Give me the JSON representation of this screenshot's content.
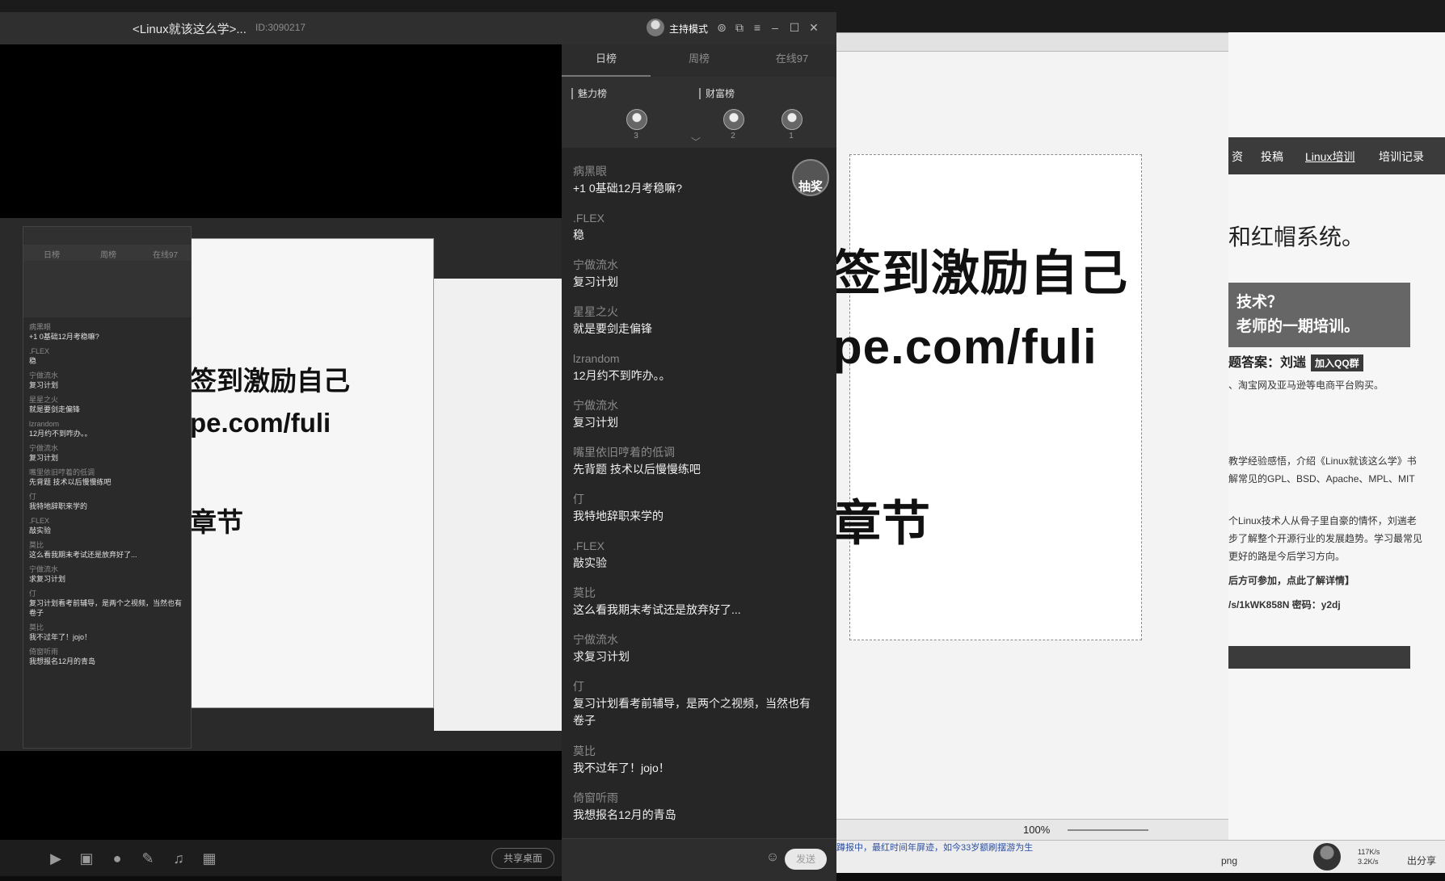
{
  "window": {
    "room_title": "<Linux就该这么学>...",
    "room_id": "ID:3090217",
    "host_mode_label": "主持模式"
  },
  "panel": {
    "tabs": [
      "日榜",
      "周榜",
      "在线97"
    ],
    "active_tab": "日榜",
    "rank_charm_label": "魅力榜",
    "rank_wealth_label": "财富榜",
    "rank_charm": [
      {
        "rank": "3"
      }
    ],
    "rank_wealth": [
      {
        "rank": "2"
      },
      {
        "rank": "1"
      }
    ],
    "lottery_label": "抽奖"
  },
  "chat": [
    {
      "name": "病黑眼",
      "text": "+1 0基础12月考稳嘛?"
    },
    {
      "name": ".FLEX",
      "text": "稳"
    },
    {
      "name": "宁做流水",
      "text": "复习计划"
    },
    {
      "name": "星星之火",
      "text": "就是要剑走偏锋"
    },
    {
      "name": "lzrandom",
      "text": "12月约不到咋办。。"
    },
    {
      "name": "宁做流水",
      "text": "复习计划"
    },
    {
      "name": "嘴里依旧哼着的低调",
      "text": "先背题 技术以后慢慢练吧"
    },
    {
      "name": "仃",
      "text": "我特地辞职来学的"
    },
    {
      "name": ".FLEX",
      "text": "敲实验"
    },
    {
      "name": "莫比",
      "text": "这么看我期末考试还是放弃好了..."
    },
    {
      "name": "宁做流水",
      "text": "求复习计划"
    },
    {
      "name": "仃",
      "text": "复习计划看考前辅导，是两个之视频，当然也有卷子"
    },
    {
      "name": "莫比",
      "text": "我不过年了！jojo！"
    },
    {
      "name": "倚窗听雨",
      "text": "我想报名12月的青岛"
    }
  ],
  "input": {
    "placeholder": "",
    "send_label": "发送"
  },
  "toolbar": {
    "share_label": "共享桌面"
  },
  "shared_screen": {
    "big_line_1": "签到激励自己",
    "big_line_2": "pe.com/fuli",
    "big_line_3": "章节",
    "zoom": "100%",
    "web_nav": [
      "资",
      "投稿",
      "Linux培训",
      "培训记录"
    ],
    "web_heading": "和红帽系统。",
    "web_banner_1": "技术？",
    "web_banner_2": "老师的一期培训。",
    "web_answer": "题答案：刘遄",
    "web_qq": "加入QQ群",
    "web_line_1": "、淘宝网及亚马逊等电商平台购买。",
    "web_line_2": "教学经验感悟，介绍《Linux就该这么学》书",
    "web_line_3": "解常见的GPL、BSD、Apache、MPL、MIT",
    "web_line_4": "个Linux技术人从骨子里自豪的情怀，刘遄老",
    "web_line_5": "步了解整个开源行业的发展趋势。学习最常见",
    "web_line_6": "更好的路是今后学习方向。",
    "web_line_7": "后方可参加，点此了解详情】",
    "web_line_8": "/s/1kWK858N 密码：y2dj"
  },
  "taskbar": {
    "marquee": "蹲报中，最红时间年屏迹，如今33岁额刷摆游为生",
    "png_label": "png",
    "speed_up": "117K/s",
    "speed_down": "3.2K/s",
    "share_label": "出分享"
  }
}
